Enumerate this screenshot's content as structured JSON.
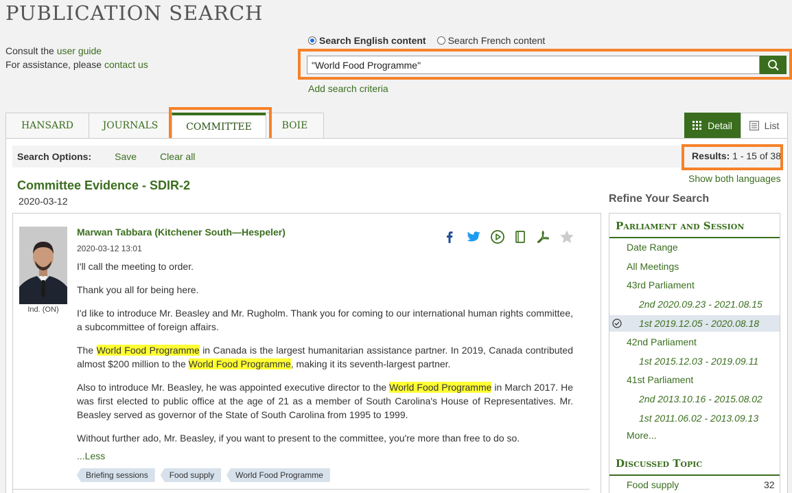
{
  "page": {
    "title": "PUBLICATION SEARCH",
    "help_prefix1": "Consult the ",
    "help_link1": "user guide",
    "help_prefix2": "For assistance, please ",
    "help_link2": "contact us"
  },
  "search": {
    "lang_en": "Search English content",
    "lang_fr": "Search French content",
    "selected_lang": "en",
    "value": "\"World Food Programme\"",
    "add_criteria": "Add search criteria",
    "icon": "search-icon"
  },
  "tabs": [
    {
      "label": "HANSARD",
      "active": false
    },
    {
      "label": "JOURNALS",
      "active": false
    },
    {
      "label": "COMMITTEE",
      "active": true
    },
    {
      "label": "BOIE",
      "active": false
    }
  ],
  "view": {
    "detail": "Detail",
    "list": "List",
    "selected": "detail"
  },
  "options": {
    "label": "Search Options:",
    "save": "Save",
    "clear": "Clear all",
    "results_label": "Results:",
    "results_value": " 1 - 15 of 38",
    "show_both": "Show both languages"
  },
  "result": {
    "title": "Committee Evidence - SDIR-2",
    "date": "2020-03-12",
    "speaker": "Marwan Tabbara (Kitchener South—Hespeler)",
    "timestamp": "2020-03-12 13:01",
    "affiliation": "Ind. (ON)",
    "p1": "I'll call the meeting to order.",
    "p2": "Thank you all for being here.",
    "p3": "I'd like to introduce Mr. Beasley and Mr. Rugholm. Thank you for coming to our international human rights committee, a subcommittee of foreign affairs.",
    "p4a": "The ",
    "hl": "World Food Programme",
    "p4b": " in Canada is the largest humanitarian assistance partner. In 2019, Canada contributed almost $200 million to the ",
    "p4c": ", making it its seventh-largest partner.",
    "p5a": "Also to introduce Mr. Beasley, he was appointed executive director to the ",
    "p5b": " in March 2017. He was first elected to public office at the age of 21 as a member of South Carolina's House of Representatives. Mr. Beasley served as governor of the State of South Carolina from 1995 to 1999.",
    "p6": "Without further ado, Mr. Beasley, if you want to present to the committee, you're more than free to do so.",
    "less": "...Less",
    "tags": [
      "Briefing sessions",
      "Food supply",
      "World Food Programme"
    ]
  },
  "refine": {
    "title": "Refine Your Search",
    "parliament_head": "Parliament and Session",
    "items": {
      "date_range": "Date Range",
      "all_meetings": "All Meetings",
      "p43": "43rd Parliament",
      "p43s2": "2nd 2020.09.23 - 2021.08.15",
      "p43s1": "1st 2019.12.05 - 2020.08.18",
      "p42": "42nd Parliament",
      "p42s1": "1st 2015.12.03 - 2019.09.11",
      "p41": "41st Parliament",
      "p41s2": "2nd 2013.10.16 - 2015.08.02",
      "p41s1": "1st 2011.06.02 - 2013.09.13",
      "more": "More..."
    },
    "topic_head": "Discussed Topic",
    "topic_food": "Food supply",
    "topic_food_count": "32"
  },
  "colors": {
    "brand_green": "#3a6e1e",
    "highlight": "#ffff33",
    "annotation_orange": "#f5822a"
  }
}
